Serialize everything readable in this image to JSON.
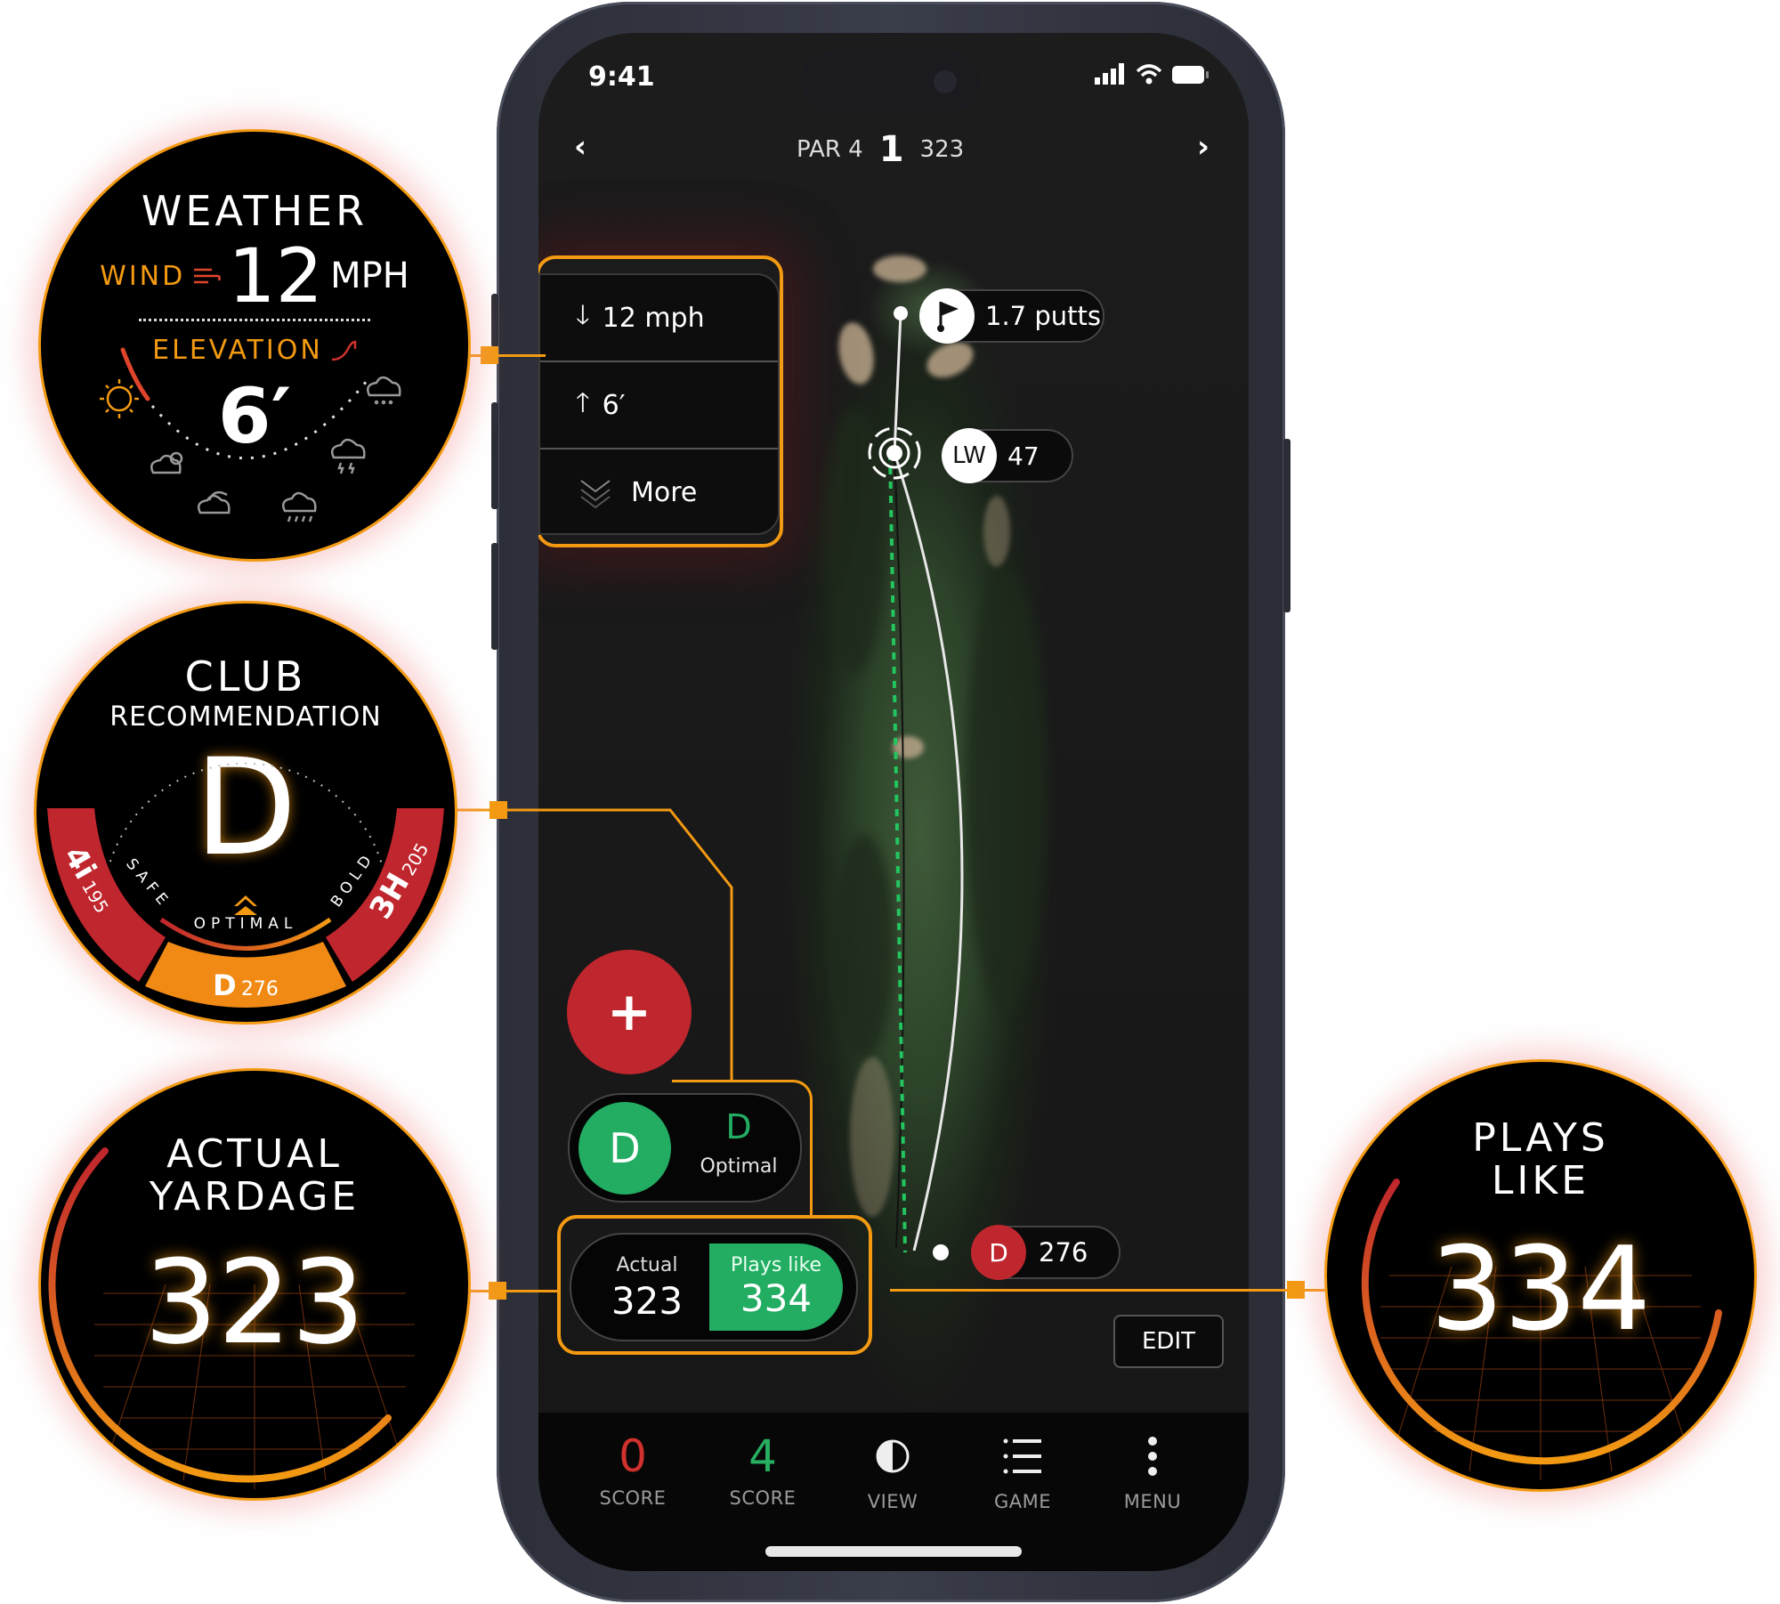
{
  "status_bar": {
    "time": "9:41",
    "signal_icon": "cellular-signal-icon",
    "wifi_icon": "wifi-icon",
    "battery_icon": "battery-icon"
  },
  "hole_header": {
    "par_label": "PAR 4",
    "hole_number": "1",
    "yardage": "323",
    "prev_icon": "chevron-left-icon",
    "next_icon": "chevron-right-icon"
  },
  "conditions_panel": {
    "wind": {
      "icon": "arrow-down-icon",
      "value": "12 mph"
    },
    "elevation": {
      "icon": "arrow-up-icon",
      "value": "6′"
    },
    "more": {
      "icon": "double-chevron-down-icon",
      "label": "More"
    }
  },
  "map_markers": {
    "pin": {
      "icon": "flag-icon",
      "label": "1.7 putts"
    },
    "layup": {
      "club": "LW",
      "distance": "47"
    },
    "tee_shot": {
      "club": "D",
      "distance": "276"
    }
  },
  "add_button": {
    "icon": "plus-icon"
  },
  "club_pill": {
    "club_badge": "D",
    "club": "D",
    "caption": "Optimal"
  },
  "yardage_pill": {
    "actual_label": "Actual",
    "actual_value": "323",
    "plays_like_label": "Plays like",
    "plays_like_value": "334"
  },
  "edit_button": {
    "label": "EDIT"
  },
  "tab_bar": [
    {
      "value": "0",
      "label": "SCORE",
      "color": "#d0312d"
    },
    {
      "value": "4",
      "label": "SCORE",
      "color": "#27ae60"
    },
    {
      "icon": "contrast-icon",
      "label": "VIEW"
    },
    {
      "icon": "list-icon",
      "label": "GAME"
    },
    {
      "icon": "more-vertical-icon",
      "label": "MENU"
    }
  ],
  "callouts": {
    "weather": {
      "title": "WEATHER",
      "wind_label": "WIND",
      "wind_value": "12",
      "wind_unit": "MPH",
      "elevation_label": "ELEVATION",
      "elevation_value": "6′",
      "conditions": [
        "sunny",
        "partly-cloudy",
        "cloudy",
        "rain",
        "thunderstorm",
        "snow"
      ]
    },
    "club": {
      "title": "CLUB",
      "subtitle": "RECOMMENDATION",
      "club": "D",
      "safe_label": "SAFE",
      "bold_label": "BOLD",
      "optimal_label": "OPTIMAL",
      "safe_option": {
        "club": "4i",
        "distance": "195"
      },
      "optimal_option": {
        "club": "D",
        "distance": "276"
      },
      "bold_option": {
        "club": "3H",
        "distance": "205"
      }
    },
    "actual": {
      "title_line1": "ACTUAL",
      "title_line2": "YARDAGE",
      "value": "323"
    },
    "plays_like": {
      "title_line1": "PLAYS",
      "title_line2": "LIKE",
      "value": "334"
    }
  },
  "colors": {
    "accent_orange": "#f39a12",
    "red": "#c0262d",
    "green": "#22ad62"
  }
}
